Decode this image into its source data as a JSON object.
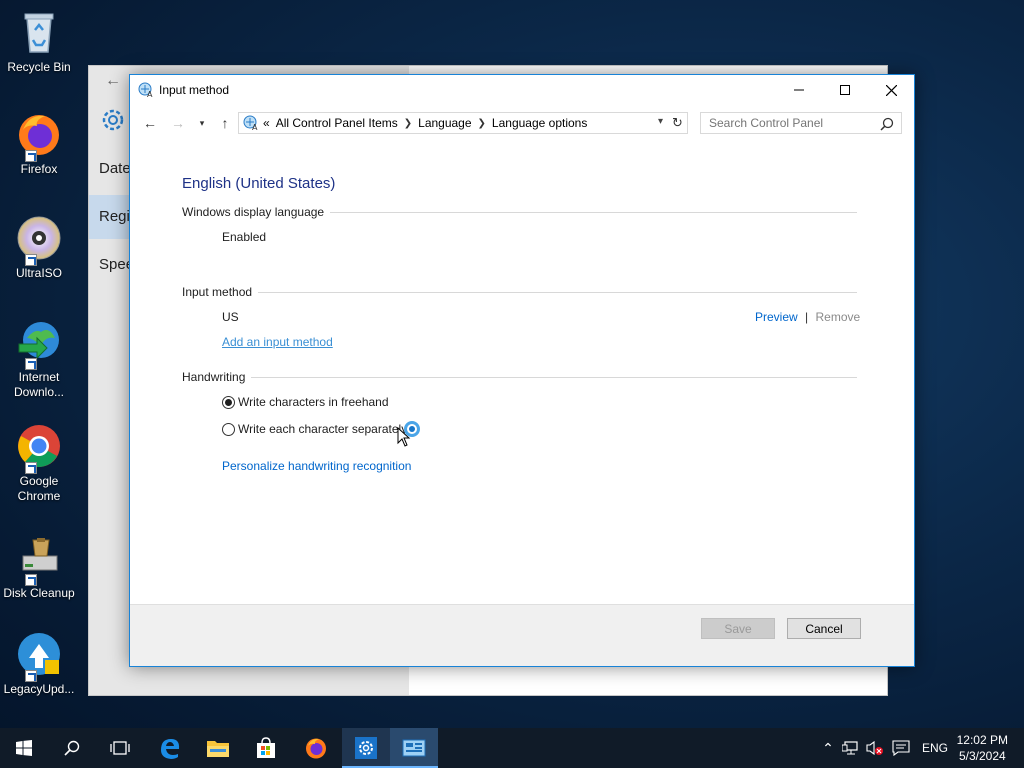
{
  "desktop": {
    "icons": [
      {
        "label": "Recycle Bin"
      },
      {
        "label": "Firefox"
      },
      {
        "label": "UltraISO"
      },
      {
        "label": "Internet Downlo..."
      },
      {
        "label": "Google Chrome"
      },
      {
        "label": "Disk Cleanup"
      },
      {
        "label": "LegacyUpd..."
      }
    ]
  },
  "background_window": {
    "nav_items": [
      "Date",
      "Regi",
      "Spee"
    ]
  },
  "dialog": {
    "title": "Input method",
    "breadcrumb": {
      "prefix": "«",
      "items": [
        "All Control Panel Items",
        "Language",
        "Language options"
      ]
    },
    "search_placeholder": "Search Control Panel",
    "language_title": "English (United States)",
    "display_language": {
      "header": "Windows display language",
      "value": "Enabled"
    },
    "input_method": {
      "header": "Input method",
      "name": "US",
      "preview_label": "Preview",
      "separator": "|",
      "remove_label": "Remove",
      "add_label": "Add an input method"
    },
    "handwriting": {
      "header": "Handwriting",
      "options": [
        {
          "label": "Write characters in freehand",
          "checked": true
        },
        {
          "label": "Write each character separately",
          "checked": false
        }
      ],
      "personalize_label": "Personalize handwriting recognition"
    },
    "buttons": {
      "save": "Save",
      "cancel": "Cancel"
    }
  },
  "taskbar": {
    "language": "ENG",
    "time": "12:02 PM",
    "date": "5/3/2024"
  },
  "colors": {
    "accent": "#1883d7",
    "link": "#0066cc",
    "title_blue": "#1e3287",
    "taskbar": "#101b28"
  }
}
